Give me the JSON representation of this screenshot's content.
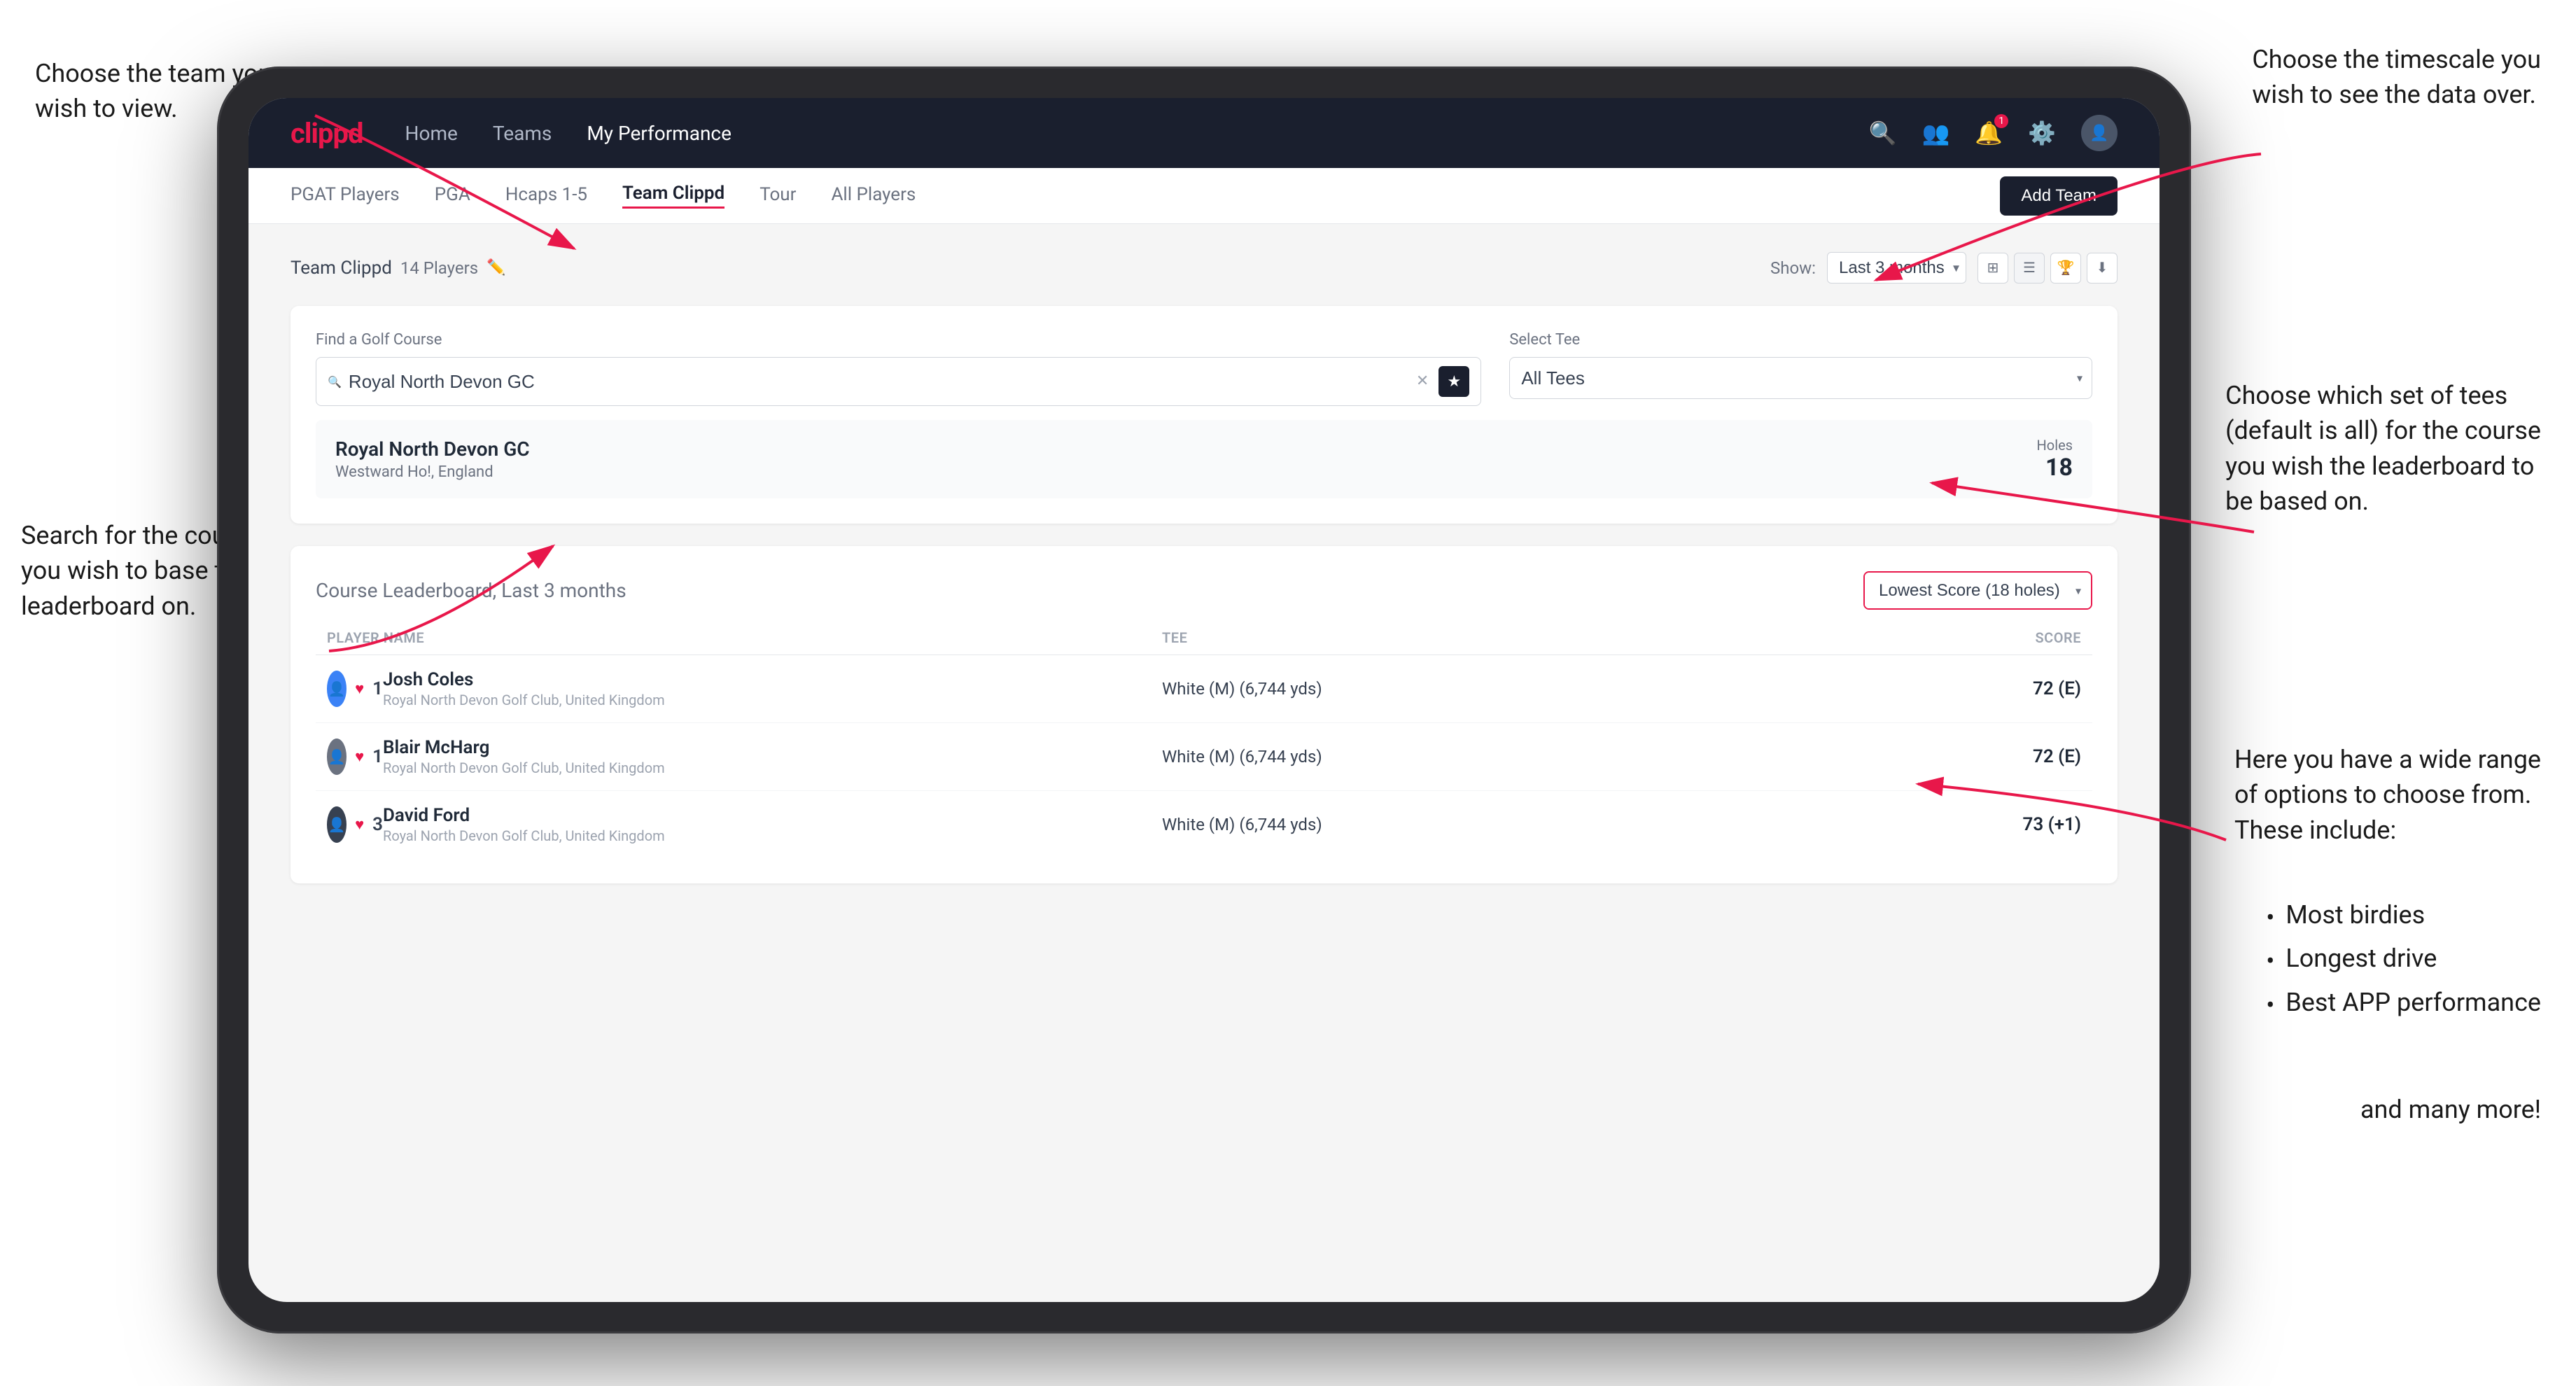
{
  "annotations": {
    "top_left_title": "Choose the team you\nwish to view.",
    "mid_left_title": "Search for the course\nyou wish to base the\nleaderboard on.",
    "top_right_title": "Choose the timescale you\nwish to see the data over.",
    "mid_right_title": "Choose which set of tees\n(default is all) for the course\nyou wish the leaderboard to\nbe based on.",
    "bottom_right_title": "Here you have a wide range\nof options to choose from.\nThese include:",
    "bullet_items": [
      "Most birdies",
      "Longest drive",
      "Best APP performance"
    ],
    "and_more": "and many more!"
  },
  "navbar": {
    "logo": "clippd",
    "links": [
      "Home",
      "Teams",
      "My Performance"
    ],
    "active_link": "My Performance"
  },
  "sub_navbar": {
    "links": [
      "PGAT Players",
      "PGA",
      "Hcaps 1-5",
      "Team Clippd",
      "Tour",
      "All Players"
    ],
    "active_link": "Team Clippd",
    "add_team_label": "Add Team"
  },
  "team_section": {
    "title": "Team Clippd",
    "player_count": "14 Players",
    "show_label": "Show:",
    "show_value": "Last 3 months"
  },
  "course_search": {
    "find_label": "Find a Golf Course",
    "search_placeholder": "Royal North Devon GC",
    "search_value": "Royal North Devon GC",
    "tee_label": "Select Tee",
    "tee_value": "All Tees"
  },
  "course_result": {
    "name": "Royal North Devon GC",
    "location": "Westward Ho!, England",
    "holes_label": "Holes",
    "holes_value": "18"
  },
  "leaderboard": {
    "title": "Course Leaderboard,",
    "period": "Last 3 months",
    "score_type": "Lowest Score (18 holes)",
    "columns": {
      "player_name": "PLAYER NAME",
      "tee": "TEE",
      "score": "SCORE"
    },
    "players": [
      {
        "rank": "1",
        "name": "Josh Coles",
        "club": "Royal North Devon Golf Club, United Kingdom",
        "tee": "White (M) (6,744 yds)",
        "score": "72 (E)"
      },
      {
        "rank": "1",
        "name": "Blair McHarg",
        "club": "Royal North Devon Golf Club, United Kingdom",
        "tee": "White (M) (6,744 yds)",
        "score": "72 (E)"
      },
      {
        "rank": "3",
        "name": "David Ford",
        "club": "Royal North Devon Golf Club, United Kingdom",
        "tee": "White (M) (6,744 yds)",
        "score": "73 (+1)"
      }
    ]
  }
}
